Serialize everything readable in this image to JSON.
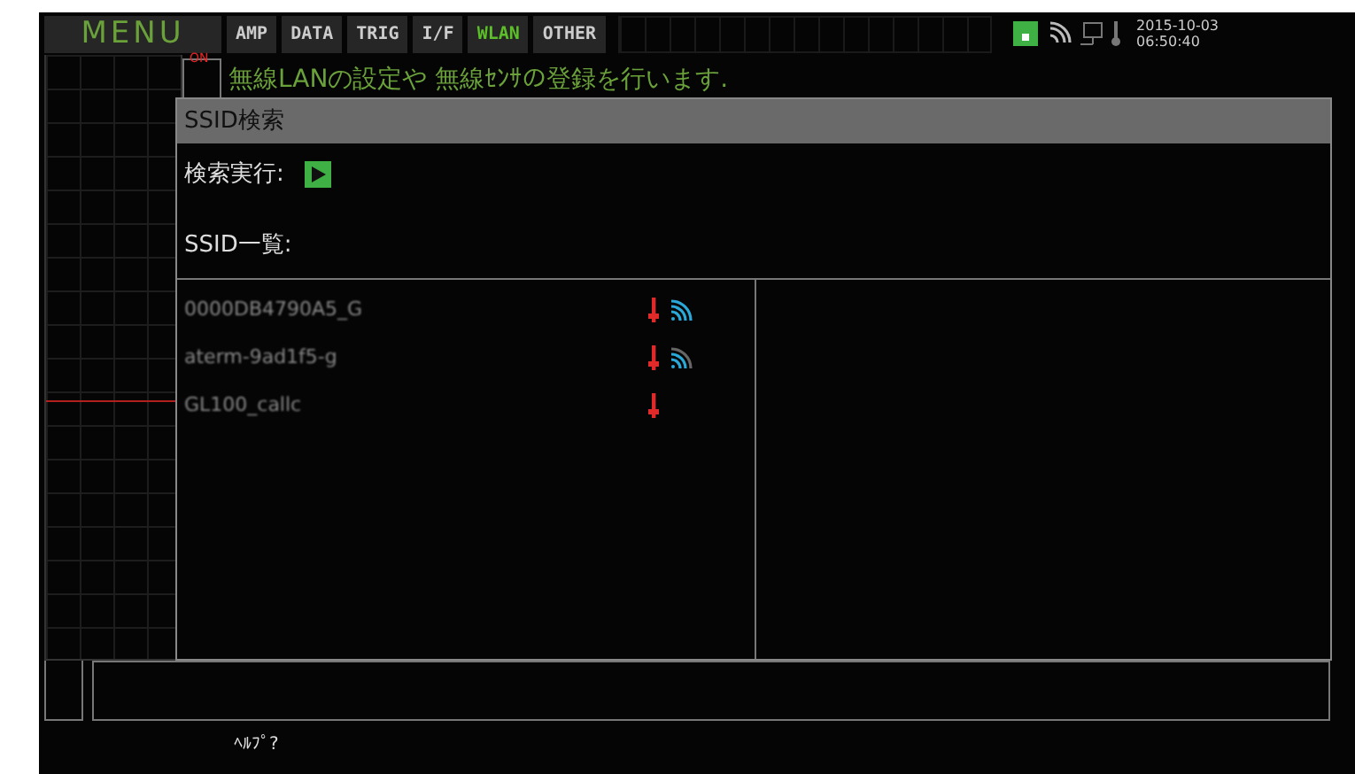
{
  "menu": {
    "label": "MENU"
  },
  "tabs": [
    {
      "label": "AMP",
      "selected": false
    },
    {
      "label": "DATA",
      "selected": false
    },
    {
      "label": "TRIG",
      "selected": false
    },
    {
      "label": "I/F",
      "selected": false
    },
    {
      "label": "WLAN",
      "selected": true
    },
    {
      "label": "OTHER",
      "selected": false
    }
  ],
  "status": {
    "date": "2015-10-03",
    "time": "06:50:40"
  },
  "channel_badge": "ON",
  "message": "無線LANの設定や 無線ｾﾝｻの登録を行います.",
  "dialog": {
    "title": "SSID検索",
    "search_label": "検索実行:",
    "list_label": "SSID一覧:",
    "ssids": [
      {
        "name": "0000DB4790A5_G",
        "kind": "strong"
      },
      {
        "name": "aterm-9ad1f5-g",
        "kind": "medium"
      },
      {
        "name": "GL100_callc",
        "kind": "none"
      }
    ]
  },
  "help": "ﾍﾙﾌﾟ?"
}
